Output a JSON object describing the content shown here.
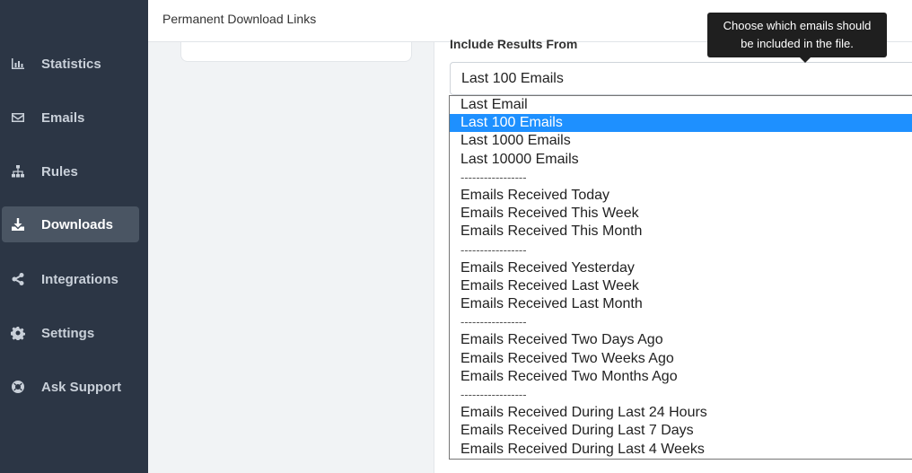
{
  "header": {
    "title": "Permanent Download Links"
  },
  "sidebar": {
    "items": [
      {
        "label": "Statistics",
        "icon": "bar-chart-icon",
        "active": false
      },
      {
        "label": "Emails",
        "icon": "envelope-icon",
        "active": false
      },
      {
        "label": "Rules",
        "icon": "sitemap-icon",
        "active": false
      },
      {
        "label": "Downloads",
        "icon": "download-icon",
        "active": true
      },
      {
        "label": "Integrations",
        "icon": "share-icon",
        "active": false
      },
      {
        "label": "Settings",
        "icon": "gear-icon",
        "active": false
      },
      {
        "label": "Ask Support",
        "icon": "lifebuoy-icon",
        "active": false
      }
    ]
  },
  "form": {
    "label": "Include Results From",
    "selected_value": "Last 100 Emails"
  },
  "tooltip": {
    "line1": "Choose which emails should",
    "line2": "be included in the file."
  },
  "dropdown": {
    "options": [
      "Last Email",
      "Last 100 Emails",
      "Last 1000 Emails",
      "Last 10000 Emails",
      "-----------------",
      "Emails Received Today",
      "Emails Received This Week",
      "Emails Received This Month",
      "-----------------",
      "Emails Received Yesterday",
      "Emails Received Last Week",
      "Emails Received Last Month",
      "-----------------",
      "Emails Received Two Days Ago",
      "Emails Received Two Weeks Ago",
      "Emails Received Two Months Ago",
      "-----------------",
      "Emails Received During Last 24 Hours",
      "Emails Received During Last 7 Days",
      "Emails Received During Last 4 Weeks"
    ]
  },
  "colors": {
    "sidebar_bg": "#2c3645",
    "active_item_bg": "#4a5563",
    "selected_option_bg": "#1e90ff"
  }
}
